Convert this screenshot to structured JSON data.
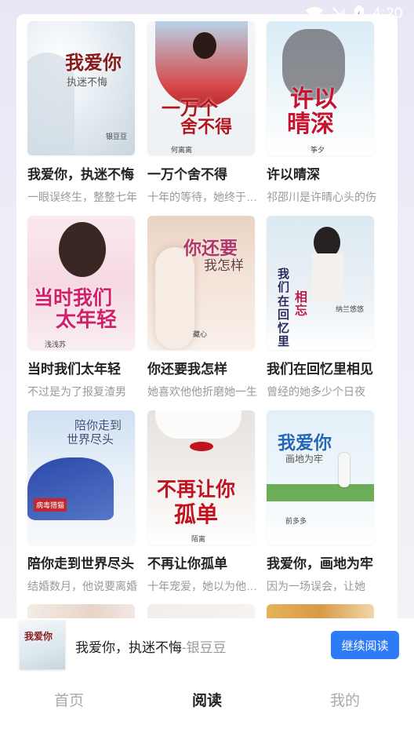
{
  "status_bar": {
    "time": "4:20"
  },
  "books": [
    {
      "title": "我爱你，执迷不悔",
      "desc": "一眼误终生，整整七年",
      "cover_title": "我爱你",
      "cover_sub": "执迷不悔",
      "cover_author": "银豆豆"
    },
    {
      "title": "一万个舍不得",
      "desc": "十年的等待，她终于等到了",
      "cover_title": "一万个",
      "cover_sub": "舍不得",
      "cover_author": "何离离"
    },
    {
      "title": "许以晴深",
      "desc": "祁邵川是许晴心头的伤",
      "cover_title": "许以",
      "cover_sub": "晴深",
      "cover_author": "筝夕"
    },
    {
      "title": "当时我们太年轻",
      "desc": "不过是为了报复渣男",
      "cover_title": "当时我们",
      "cover_sub": "太年轻",
      "cover_author": "浅浅苏"
    },
    {
      "title": "你还要我怎样",
      "desc": "她喜欢他他折磨她一生",
      "cover_title": "你还要",
      "cover_sub": "我怎样",
      "cover_author": "藏心"
    },
    {
      "title": "我们在回忆里相见",
      "desc": "曾经的她多少个日夜",
      "cover_title": "我们在回忆里",
      "cover_sub": "相忘",
      "cover_author": "纳兰悠悠"
    },
    {
      "title": "陪你走到世界尽头",
      "desc": "结婚数月，他说要离婚",
      "cover_title": "陪你走到",
      "cover_sub": "世界尽头",
      "cover_author": "病毒猎猫"
    },
    {
      "title": "不再让你孤单",
      "desc": "十年宠爱，她以为他爱她",
      "cover_title": "不再让你",
      "cover_sub": "孤单",
      "cover_author": "陌离"
    },
    {
      "title": "我爱你，画地为牢",
      "desc": "因为一场误会，让她",
      "cover_title": "我爱你",
      "cover_sub": "画地为牢",
      "cover_author": "前多多"
    }
  ],
  "mini_player": {
    "book_title": "我爱你，执迷不悔",
    "author": "-银豆豆",
    "cover_text": "我爱你",
    "button_label": "继续阅读"
  },
  "tabs": [
    {
      "label": "首页"
    },
    {
      "label": "阅读"
    },
    {
      "label": "我的"
    }
  ],
  "colors": {
    "accent": "#2d7bf6",
    "active_tab": "#222222",
    "inactive_tab": "#aaaaaa"
  }
}
